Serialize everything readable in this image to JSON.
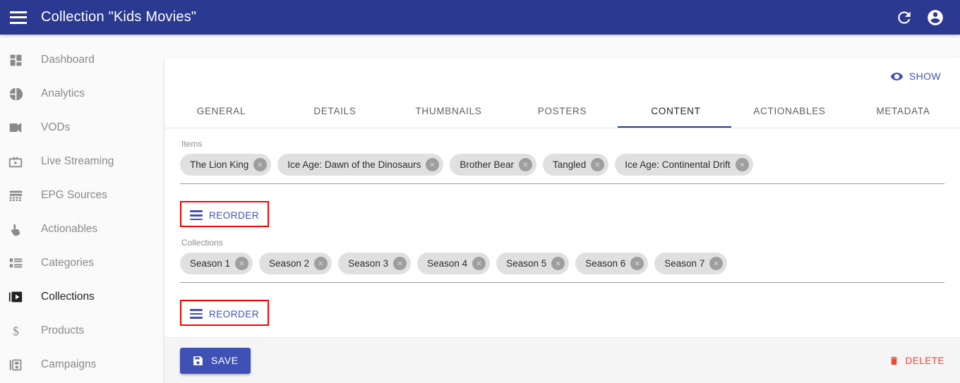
{
  "appbar": {
    "title": "Collection \"Kids Movies\"",
    "menu_icon": "hamburger-menu-icon",
    "refresh_icon": "refresh-icon",
    "account_icon": "account-circle-icon",
    "background_color": "#2b3990"
  },
  "sidebar": {
    "items": [
      {
        "label": "Dashboard",
        "icon": "dashboard-icon",
        "active": false
      },
      {
        "label": "Analytics",
        "icon": "pie-chart-icon",
        "active": false
      },
      {
        "label": "VODs",
        "icon": "video-camera-icon",
        "active": false
      },
      {
        "label": "Live Streaming",
        "icon": "tv-icon",
        "active": false
      },
      {
        "label": "EPG Sources",
        "icon": "list-grid-icon",
        "active": false
      },
      {
        "label": "Actionables",
        "icon": "touch-pointer-icon",
        "active": false
      },
      {
        "label": "Categories",
        "icon": "list-icon",
        "active": false
      },
      {
        "label": "Collections",
        "icon": "video-library-icon",
        "active": true
      },
      {
        "label": "Products",
        "icon": "dollar-sign-icon",
        "active": false
      },
      {
        "label": "Campaigns",
        "icon": "campaign-icon",
        "active": false
      }
    ]
  },
  "main": {
    "show_label": "SHOW",
    "show_icon": "eye-icon",
    "tabs": [
      {
        "label": "GENERAL",
        "active": false
      },
      {
        "label": "DETAILS",
        "active": false
      },
      {
        "label": "THUMBNAILS",
        "active": false
      },
      {
        "label": "POSTERS",
        "active": false
      },
      {
        "label": "CONTENT",
        "active": true
      },
      {
        "label": "ACTIONABLES",
        "active": false
      },
      {
        "label": "METADATA",
        "active": false
      }
    ],
    "items_section": {
      "label": "Items",
      "chips": [
        "The Lion King",
        "Ice Age: Dawn of the Dinosaurs",
        "Brother Bear",
        "Tangled",
        "Ice Age: Continental Drift"
      ],
      "reorder_label": "REORDER",
      "reorder_icon": "reorder-lines-icon",
      "reorder_highlighted": true
    },
    "collections_section": {
      "label": "Collections",
      "chips": [
        "Season 1",
        "Season 2",
        "Season 3",
        "Season 4",
        "Season 5",
        "Season 6",
        "Season 7"
      ],
      "reorder_label": "REORDER",
      "reorder_icon": "reorder-lines-icon",
      "reorder_highlighted": true
    },
    "footer": {
      "save_label": "SAVE",
      "save_icon": "floppy-disk-save-icon",
      "delete_label": "DELETE",
      "delete_icon": "trash-can-icon"
    }
  },
  "colors": {
    "appbar": "#2b3990",
    "accent": "#3f51b5",
    "danger": "#f44336",
    "highlight_box": "#ff0000",
    "chip_bg": "#e0e0e0",
    "page_bg": "#fafafa"
  }
}
